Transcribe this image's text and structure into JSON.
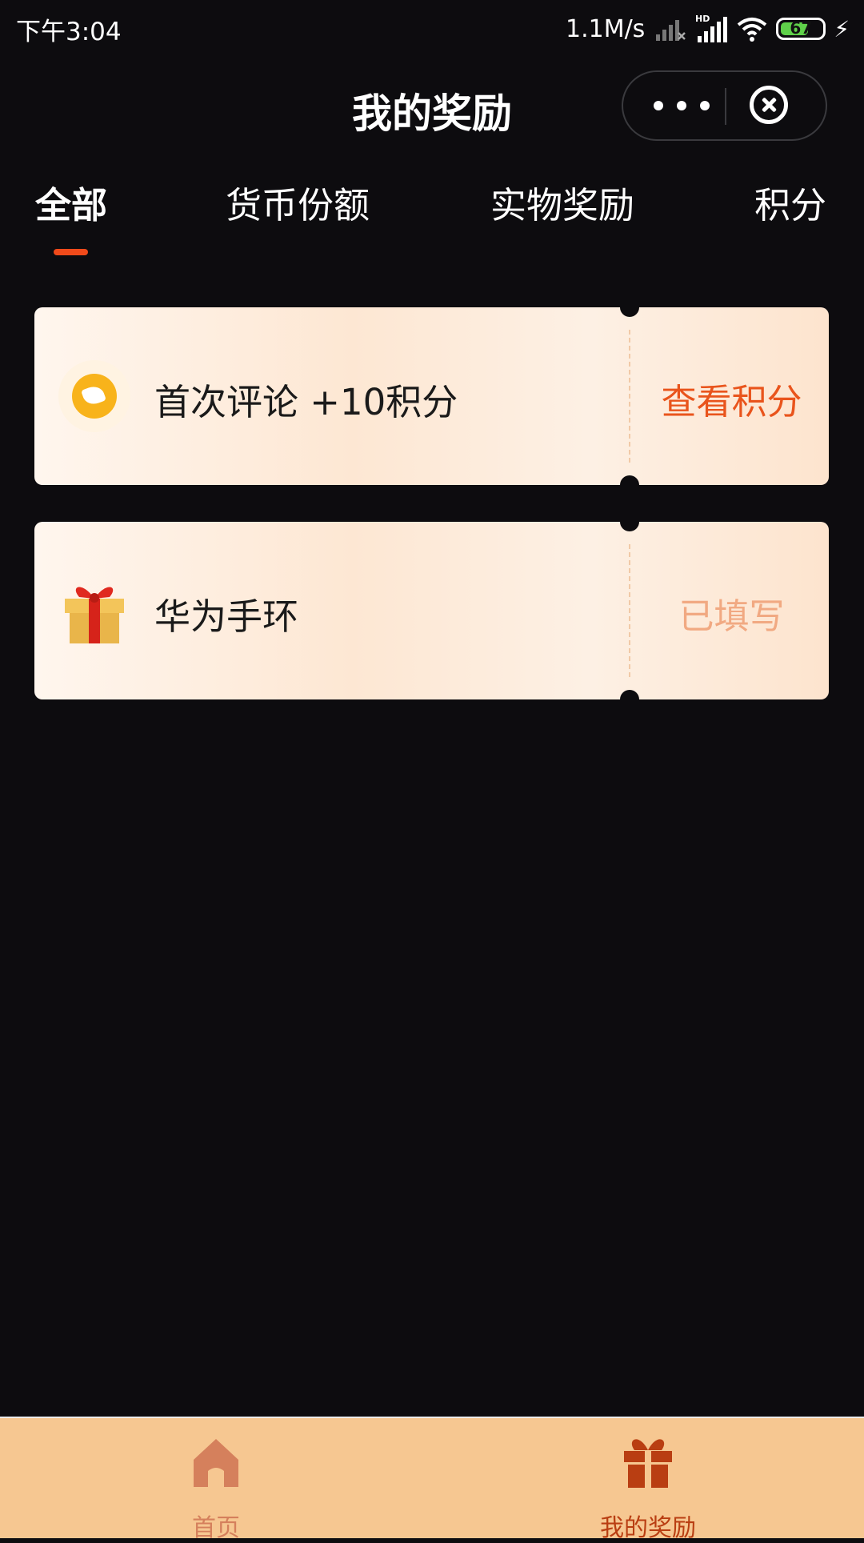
{
  "status_bar": {
    "time": "下午3:04",
    "net_speed": "1.1M/s",
    "hd_label": "HD",
    "battery_level": "67"
  },
  "header": {
    "title": "我的奖励"
  },
  "tabs": [
    {
      "label": "全部",
      "active": true
    },
    {
      "label": "货币份额",
      "active": false
    },
    {
      "label": "实物奖励",
      "active": false
    },
    {
      "label": "积分",
      "active": false
    }
  ],
  "rewards": [
    {
      "icon": "points-coin-icon",
      "title": "首次评论 +10积分",
      "action": "查看积分",
      "action_color": "#e9541c"
    },
    {
      "icon": "gift-box-icon",
      "title": "华为手环",
      "action": "已填写",
      "action_color": "#f1a982"
    }
  ],
  "bottom_nav": [
    {
      "icon": "home-icon",
      "label": "首页",
      "color": "#d5805c"
    },
    {
      "icon": "gift-icon",
      "label": "我的奖励",
      "color": "#b93e12"
    }
  ],
  "colors": {
    "background": "#0d0c0f",
    "accent": "#f04a1a",
    "bottom_bar": "#f6c791"
  }
}
